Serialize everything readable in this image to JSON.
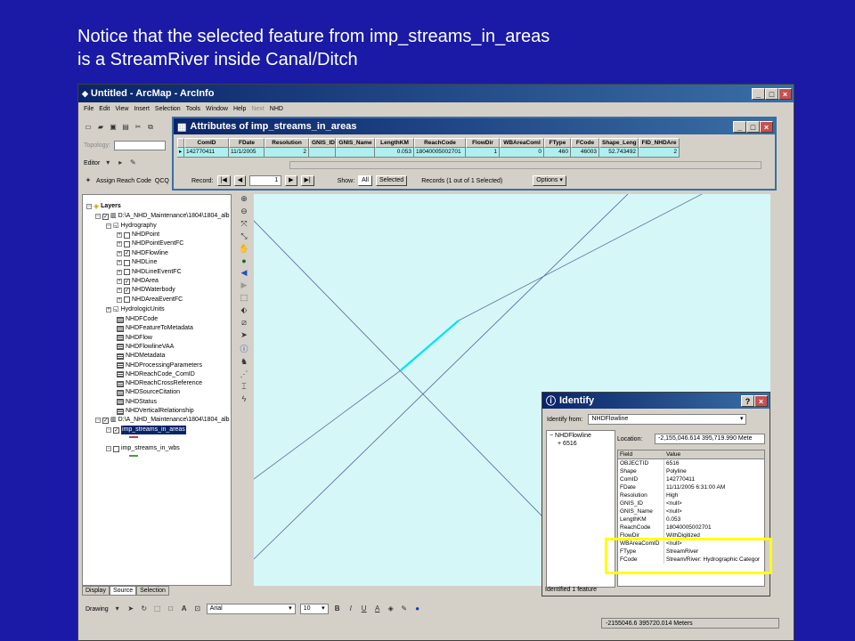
{
  "caption": {
    "line1": "Notice that the selected feature from imp_streams_in_areas",
    "line2": "is a StreamRiver inside Canal/Ditch"
  },
  "app": {
    "title": "Untitled - ArcMap - ArcInfo",
    "menu": [
      "File",
      "Edit",
      "View",
      "Insert",
      "Selection",
      "Tools",
      "Window",
      "Help",
      "Next",
      "NHD"
    ],
    "topology_label": "Topology:",
    "editor_label": "Editor",
    "assign_reach_label": "Assign Reach Code",
    "assign_reach_extra": "QCQ"
  },
  "toc": {
    "root": "Layers",
    "group1": "D:\\A_NHD_Maintenance\\1804\\1804_alb",
    "hydro": "Hydrography",
    "hydro_layers": [
      {
        "label": "NHDPoint",
        "checked": false
      },
      {
        "label": "NHDPointEventFC",
        "checked": false
      },
      {
        "label": "NHDFlowline",
        "checked": true
      },
      {
        "label": "NHDLine",
        "checked": false
      },
      {
        "label": "NHDLineEventFC",
        "checked": false
      },
      {
        "label": "NHDArea",
        "checked": true
      },
      {
        "label": "NHDWaterbody",
        "checked": true
      },
      {
        "label": "NHDAreaEventFC",
        "checked": false
      }
    ],
    "hydrologic": "HydrologicUnits",
    "tables": [
      "NHDFCode",
      "NHDFeatureToMetadata",
      "NHDFlow",
      "NHDFlowlineVAA",
      "NHDMetadata",
      "NHDProcessingParameters",
      "NHDReachCode_ComID",
      "NHDReachCrossReference",
      "NHDSourceCitation",
      "NHDStatus",
      "NHDVerticalRelationship"
    ],
    "group2": "D:\\A_NHD_Maintenance\\1804\\1804_alb",
    "layer_sel": "imp_streams_in_areas",
    "layer_wbs": "imp_streams_in_wbs",
    "tabs": [
      "Display",
      "Source",
      "Selection"
    ]
  },
  "attributes": {
    "title": "Attributes of imp_streams_in_areas",
    "columns": [
      "ComID",
      "FDate",
      "Resolution",
      "GNIS_ID",
      "GNIS_Name",
      "LengthKM",
      "ReachCode",
      "FlowDir",
      "WBAreaComI",
      "FType",
      "FCode",
      "Shape_Leng",
      "FID_NHDAre"
    ],
    "row": [
      "142770411",
      "11/1/2005",
      "2",
      "",
      "",
      "0.053",
      "18040005002701",
      "1",
      "0",
      "460",
      "46003",
      "52.743492",
      "2"
    ],
    "record_label": "Record:",
    "record_value": "1",
    "show_label": "Show:",
    "all_label": "All",
    "selected_label": "Selected",
    "records_text": "Records (1 out of 1 Selected)",
    "options_label": "Options"
  },
  "identify": {
    "title": "Identify",
    "from_label": "Identify from:",
    "from_value": "NHDFlowline",
    "tree_layer": "NHDFlowline",
    "tree_item": "6516",
    "location_label": "Location:",
    "location_value": "-2,155,046.614  395,719.990 Mete",
    "field_header": "Field",
    "value_header": "Value",
    "rows": [
      [
        "OBJECTID",
        "6516"
      ],
      [
        "Shape",
        "Polyline"
      ],
      [
        "ComID",
        "142770411"
      ],
      [
        "FDate",
        "11/11/2005 6:31:00 AM"
      ],
      [
        "Resolution",
        "High"
      ],
      [
        "GNIS_ID",
        "<null>"
      ],
      [
        "GNIS_Name",
        "<null>"
      ],
      [
        "LengthKM",
        "0.053"
      ],
      [
        "ReachCode",
        "18040005002701"
      ],
      [
        "FlowDir",
        "WithDigitized"
      ],
      [
        "WBAreaComID",
        "<null>"
      ],
      [
        "FType",
        "StreamRiver"
      ],
      [
        "FCode",
        "Stream/River: Hydrographic Categor"
      ]
    ],
    "status": "Identified 1 feature"
  },
  "drawing_bar": {
    "drawing_label": "Drawing",
    "font": "Arial",
    "size": "10"
  },
  "statusbar": "-2155046.6  395720.014 Meters",
  "colors": {
    "background": "#1a1aa6",
    "map_fill": "#d6f7f7",
    "selection": "#00e0ff",
    "highlight_box": "#ffff00"
  }
}
